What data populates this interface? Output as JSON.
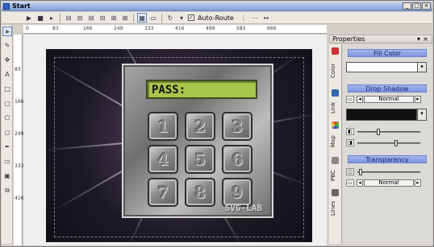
{
  "window": {
    "title": "Start",
    "minimize": "_",
    "maximize": "□",
    "close": "×"
  },
  "toolbar": {
    "auto_route_checked": "✓",
    "auto_route_label": "Auto-Route"
  },
  "rulers": {
    "h": [
      "0",
      "83",
      "166",
      "249",
      "333",
      "416",
      "499",
      "583",
      "666"
    ],
    "v": [
      "83",
      "166",
      "249",
      "333",
      "416"
    ]
  },
  "keypad": {
    "display": "PASS:",
    "keys": [
      "1",
      "2",
      "3",
      "4",
      "5",
      "6",
      "7",
      "8",
      "9"
    ],
    "brand": "SVG-LAB"
  },
  "properties": {
    "title": "Properties",
    "pin": "▾",
    "close": "×",
    "tabs": [
      "Color",
      "Link",
      "Map",
      "PBC",
      "Lines"
    ],
    "fill_color": {
      "header": "Fill Color"
    },
    "drop_shadow": {
      "header": "Drop Shadow",
      "blend_mode": "Normal"
    },
    "transparency": {
      "header": "Transparency",
      "blend_mode": "Normal"
    }
  },
  "colors": {
    "accent": "#8096df",
    "lcd": "#a9c54a",
    "shadow_color": "#111111"
  }
}
